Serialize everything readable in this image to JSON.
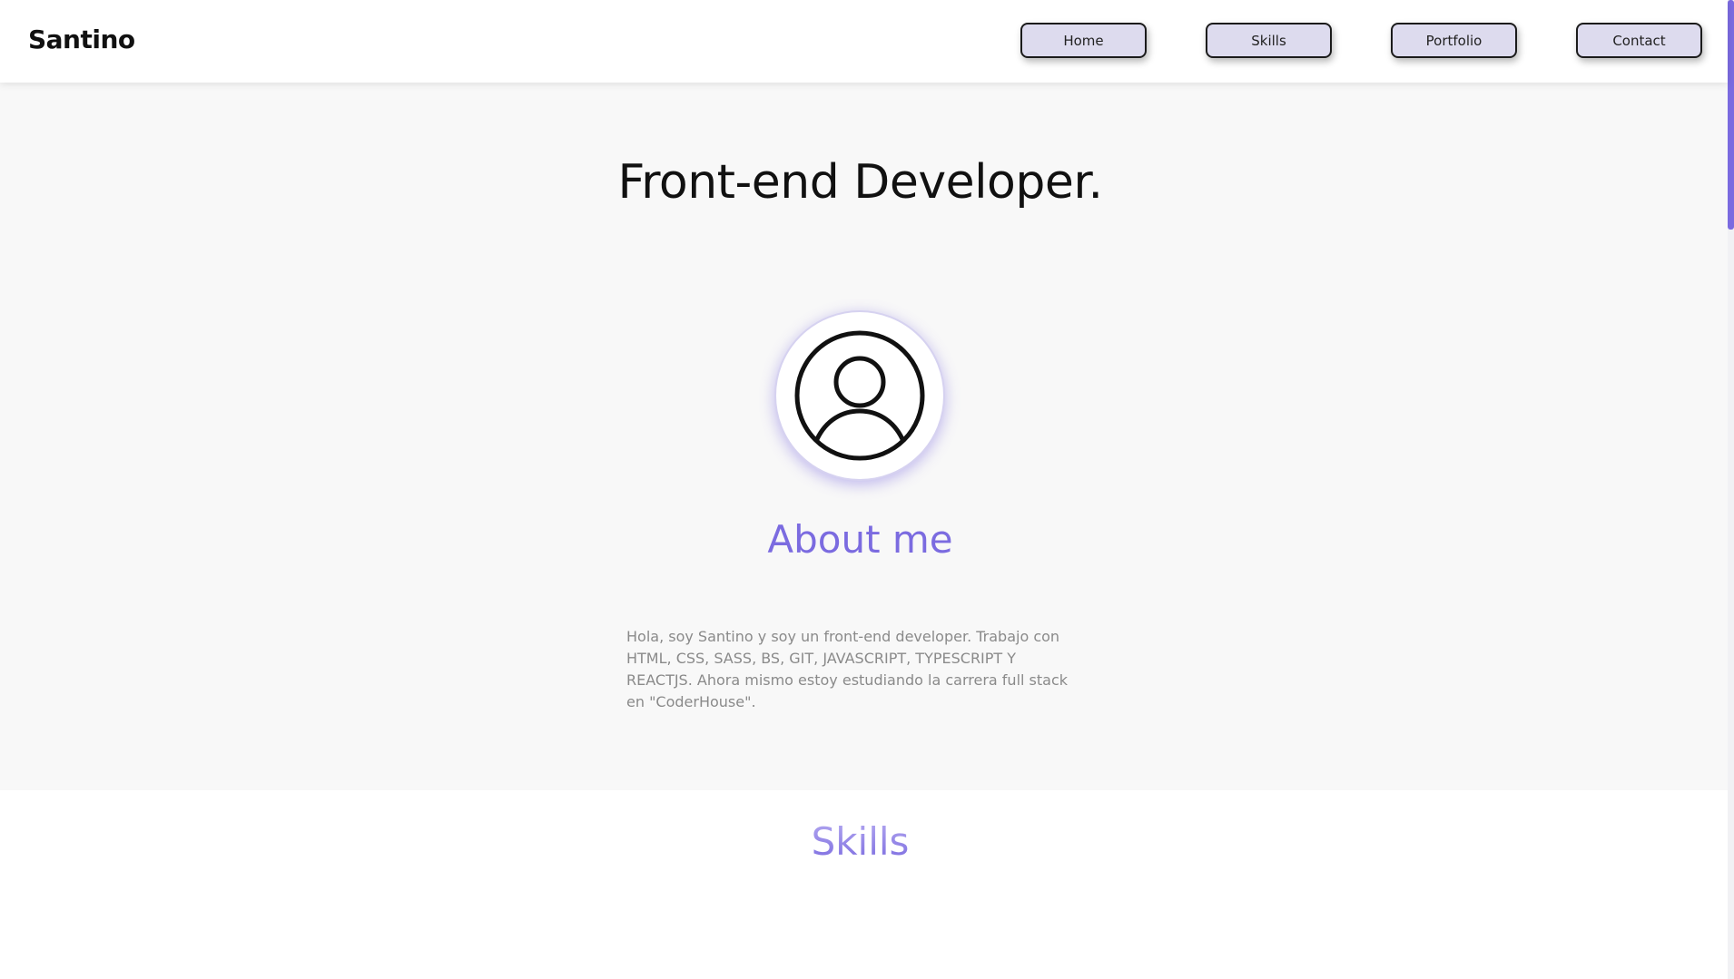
{
  "header": {
    "brand": "Santino",
    "nav": [
      {
        "label": "Home"
      },
      {
        "label": "Skills"
      },
      {
        "label": "Portfolio"
      },
      {
        "label": "Contact"
      }
    ]
  },
  "hero": {
    "headline": "Front-end Developer.",
    "avatar_icon": "user-circle-icon",
    "about_title": "About me",
    "about_text": "Hola, soy Santino y soy un front-end developer. Trabajo con HTML, CSS, SASS, BS, GIT, JAVASCRIPT, TYPESCRIPT Y REACTJS. Ahora mismo estoy estudiando la carrera full stack en \"CoderHouse\"."
  },
  "skills": {
    "title": "Skills"
  },
  "colors": {
    "accent": "#7b6be0",
    "nav_button_bg": "#dddbee",
    "section_bg": "#f8f8f8"
  }
}
